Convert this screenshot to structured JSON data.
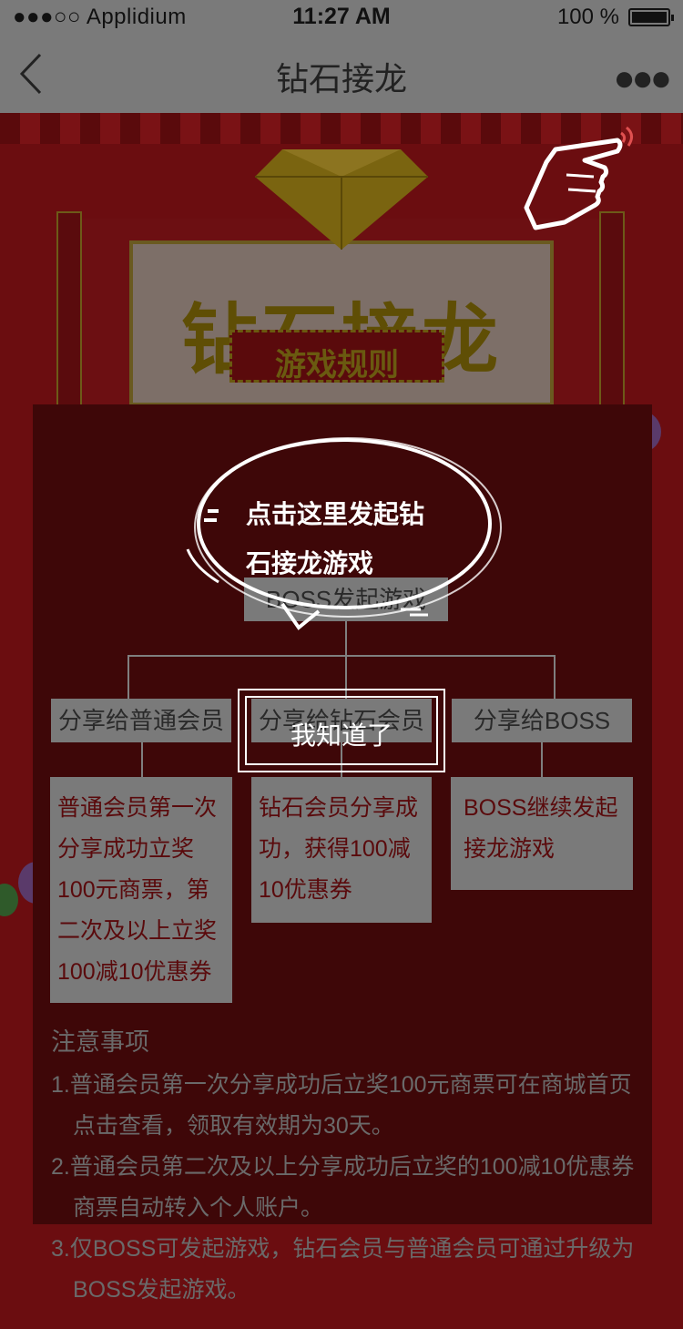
{
  "status_bar": {
    "carrier": "●●●○○ Applidium",
    "time": "11:27 AM",
    "battery": "100 %"
  },
  "nav": {
    "title": "钻石接龙"
  },
  "banner": {
    "title": "钻石接龙",
    "rules_tag": "游戏规则"
  },
  "flow": {
    "start": "BOSS发起游戏",
    "branches": [
      "分享给普通会员",
      "分享给钻石会员",
      "分享给BOSS"
    ],
    "results": [
      [
        "普通会员第一次",
        "分享成功立奖",
        "100元商票，第",
        "二次及以上立奖",
        "100减10优惠券"
      ],
      [
        "钻石会员分享成",
        "功，获得100减",
        "10优惠券"
      ],
      [
        "BOSS继续发起",
        "接龙游戏"
      ]
    ]
  },
  "notice": {
    "heading": "注意事项",
    "items": [
      "1.普通会员第一次分享成功后立奖100元商票可在商城首页点击查看，领取有效期为30天。",
      "2.普通会员第二次及以上分享成功后立奖的100减10优惠券商票自动转入个人账户。",
      "3.仅BOSS可发起游戏，钻石会员与普通会员可通过升级为BOSS发起游戏。"
    ]
  },
  "overlay": {
    "tip_line1": "点击这里发起钻",
    "tip_line2": "石接龙游戏",
    "got_it": "我知道了"
  }
}
